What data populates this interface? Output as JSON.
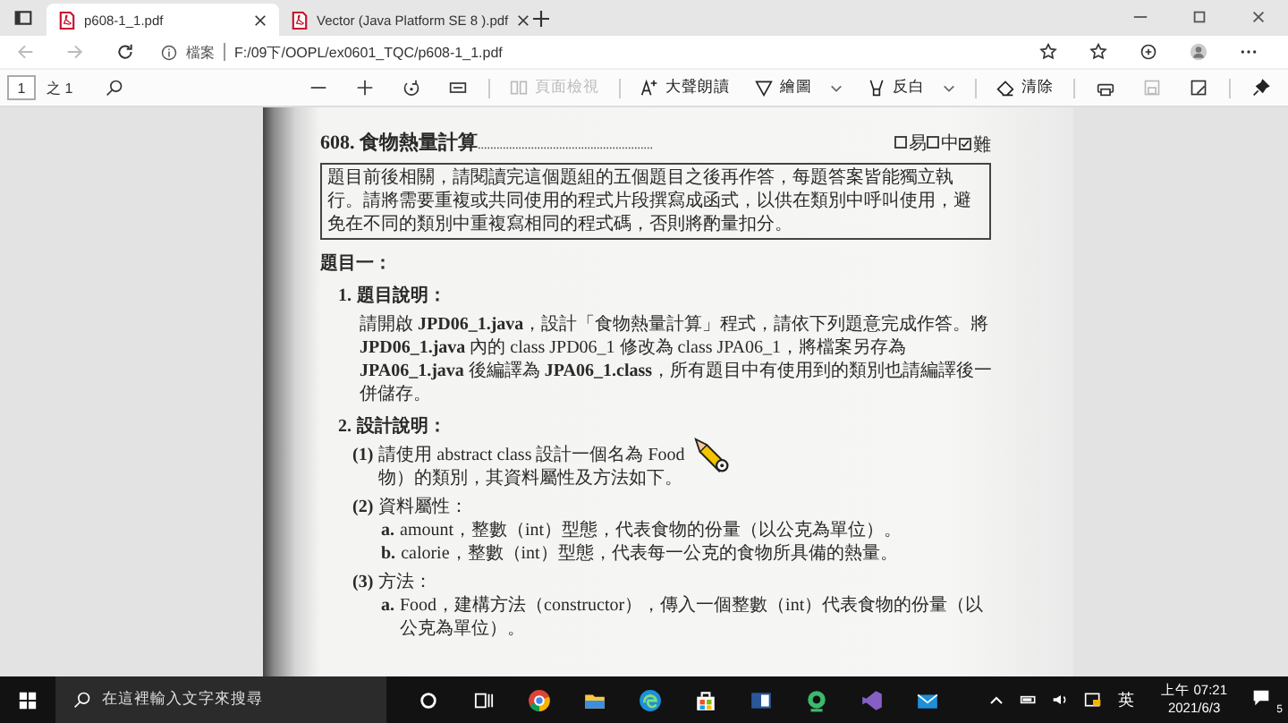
{
  "browser": {
    "tabs": [
      {
        "title": "p608-1_1.pdf",
        "selected": true
      },
      {
        "title": "Vector (Java Platform SE 8 ).pdf",
        "selected": false
      }
    ],
    "address": {
      "label": "檔案",
      "url": "F:/09下/OOPL/ex0601_TQC/p608-1_1.pdf"
    }
  },
  "pdf_toolbar": {
    "page": "1",
    "page_count": "之 1",
    "tools": [
      {
        "label": "頁面檢視",
        "disabled": true,
        "has_menu": false
      },
      {
        "label": "大聲朗讀",
        "disabled": false,
        "has_menu": false
      },
      {
        "label": "繪圖",
        "disabled": false,
        "has_menu": true
      },
      {
        "label": "反白",
        "disabled": false,
        "has_menu": true
      },
      {
        "label": "清除",
        "disabled": false,
        "has_menu": false
      }
    ]
  },
  "document": {
    "title": "608. 食物熱量計算",
    "leader": "........................................................",
    "levels": [
      {
        "label": "易",
        "checked": false
      },
      {
        "label": "中",
        "checked": false
      },
      {
        "label": "難",
        "checked": true
      }
    ],
    "notice": "題目前後相關，請閱讀完這個題組的五個題目之後再作答，每題答案皆能獨立執行。請將需要重複或共同使用的程式片段撰寫成函式，以供在類別中呼叫使用，避免在不同的類別中重複寫相同的程式碼，否則將酌量扣分。",
    "blocks": [
      {
        "kind": "heading",
        "text": "題目一："
      },
      {
        "kind": "item",
        "marker": "1.",
        "text": "題目說明："
      },
      {
        "kind": "para",
        "text": "請開啟 **JPD06_1.java**，設計「食物熱量計算」程式，請依下列題意完成作答。將 **JPD06_1.java** 內的 class JPD06_1 修改為 class JPA06_1，將檔案另存為 **JPA06_1.java** 後編譯為 **JPA06_1.class**，所有題目中有使用到的類別也請編譯後一併儲存。"
      },
      {
        "kind": "item",
        "marker": "2.",
        "text": "設計說明："
      },
      {
        "kind": "sub",
        "marker": "(1)",
        "text": "請使用 abstract class 設計一個名為 Food",
        "text_after_cursor": "物）的類別，其資料屬性及方法如下。"
      },
      {
        "kind": "sub",
        "marker": "(2)",
        "text": "資料屬性："
      },
      {
        "kind": "subsub",
        "marker": "a.",
        "text": "amount，整數（int）型態，代表食物的份量（以公克為單位）。"
      },
      {
        "kind": "subsub",
        "marker": "b.",
        "text": "calorie，整數（int）型態，代表每一公克的食物所具備的熱量。"
      },
      {
        "kind": "sub",
        "marker": "(3)",
        "text": "方法："
      },
      {
        "kind": "subsub",
        "marker": "a.",
        "text": "Food，建構方法（constructor），傳入一個整數（int）代表食物的份量（以公克為單位）。"
      }
    ]
  },
  "taskbar": {
    "search_placeholder": "在這裡輸入文字來搜尋",
    "language": "英",
    "time": "上午 07:21",
    "date": "2021/6/3",
    "notification_count": "5"
  }
}
